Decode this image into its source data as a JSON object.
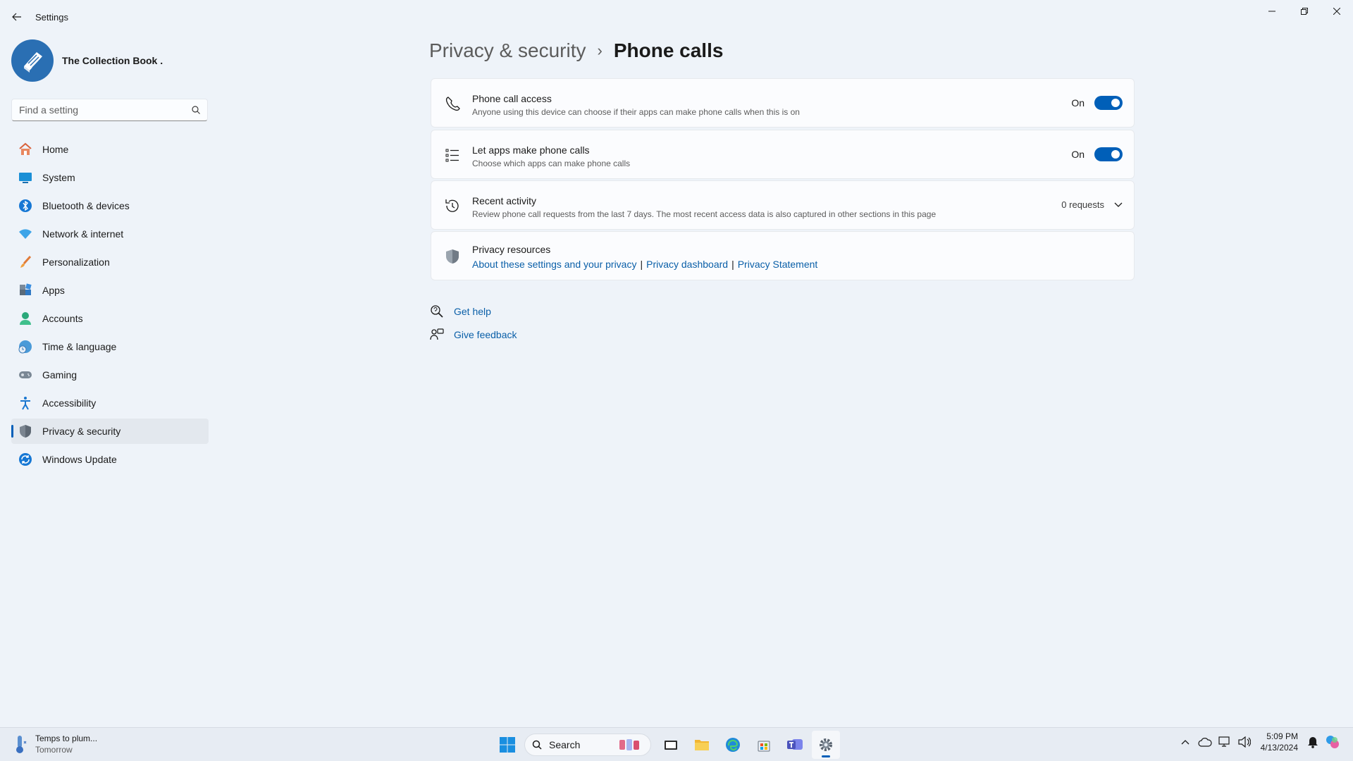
{
  "window": {
    "title": "Settings"
  },
  "profile": {
    "name": "The Collection Book ."
  },
  "search": {
    "placeholder": "Find a setting"
  },
  "nav": {
    "items": [
      {
        "label": "Home"
      },
      {
        "label": "System"
      },
      {
        "label": "Bluetooth & devices"
      },
      {
        "label": "Network & internet"
      },
      {
        "label": "Personalization"
      },
      {
        "label": "Apps"
      },
      {
        "label": "Accounts"
      },
      {
        "label": "Time & language"
      },
      {
        "label": "Gaming"
      },
      {
        "label": "Accessibility"
      },
      {
        "label": "Privacy & security"
      },
      {
        "label": "Windows Update"
      }
    ],
    "active_index": 10
  },
  "breadcrumb": {
    "parent": "Privacy & security",
    "separator": "›",
    "current": "Phone calls"
  },
  "cards": {
    "phone_call_access": {
      "title": "Phone call access",
      "description": "Anyone using this device can choose if their apps can make phone calls when this is on",
      "state": "On"
    },
    "let_apps": {
      "title": "Let apps make phone calls",
      "description": "Choose which apps can make phone calls",
      "state": "On"
    },
    "recent_activity": {
      "title": "Recent activity",
      "description": "Review phone call requests from the last 7 days. The most recent access data is also captured in other sections in this page",
      "count": "0 requests"
    },
    "privacy_resources": {
      "title": "Privacy resources",
      "links": [
        "About these settings and your privacy",
        "Privacy dashboard",
        "Privacy Statement"
      ],
      "separator": "|"
    }
  },
  "help": {
    "get_help": "Get help",
    "give_feedback": "Give feedback"
  },
  "taskbar": {
    "weather_title": "Temps to plum...",
    "weather_sub": "Tomorrow",
    "search_label": "Search",
    "time": "5:09 PM",
    "date": "4/13/2024"
  },
  "colors": {
    "accent": "#005fb8",
    "link": "#0a5fa8",
    "background": "#eef3f9"
  }
}
